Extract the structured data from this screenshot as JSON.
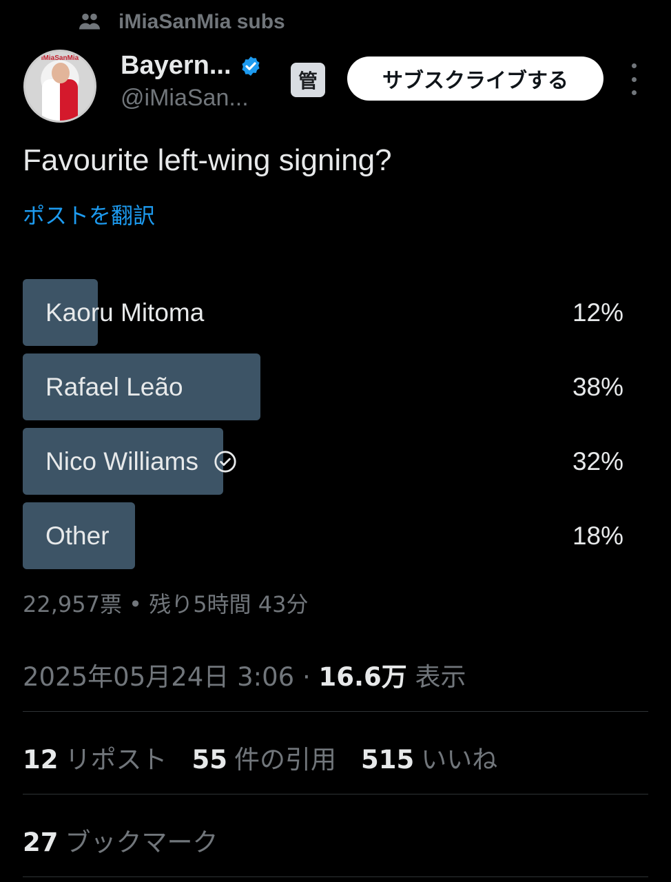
{
  "context": {
    "text": "iMiaSanMia subs",
    "icon": "people-icon"
  },
  "author": {
    "display_name": "Bayern...",
    "handle": "@iMiaSan...",
    "avatar_ring_text": "iMiaSanMia",
    "verified_color": "#1d9bf0",
    "admin_badge": "管"
  },
  "subscribe_label": "サブスクライブする",
  "tweet": {
    "text": "Favourite left-wing signing?",
    "translate_label": "ポストを翻訳"
  },
  "poll": {
    "options": [
      {
        "label": "Kaoru Mitoma",
        "percent_text": "12%",
        "percent": 12,
        "voted": false
      },
      {
        "label": "Rafael Leão",
        "percent_text": "38%",
        "percent": 38,
        "voted": false
      },
      {
        "label": "Nico Williams",
        "percent_text": "32%",
        "percent": 32,
        "voted": true
      },
      {
        "label": "Other",
        "percent_text": "18%",
        "percent": 18,
        "voted": false
      }
    ],
    "bar_color": "#3d5466",
    "meta": "22,957票 • 残り5時間 43分"
  },
  "timestamp": {
    "date": "2025年05月24日 3:06",
    "separator": "·",
    "views_count": "16.6万",
    "views_label": "表示"
  },
  "stats": {
    "reposts": {
      "count": "12",
      "label": "リポスト"
    },
    "quotes": {
      "count": "55",
      "label": "件の引用"
    },
    "likes": {
      "count": "515",
      "label": "いいね"
    }
  },
  "bookmarks": {
    "count": "27",
    "label": "ブックマーク"
  }
}
